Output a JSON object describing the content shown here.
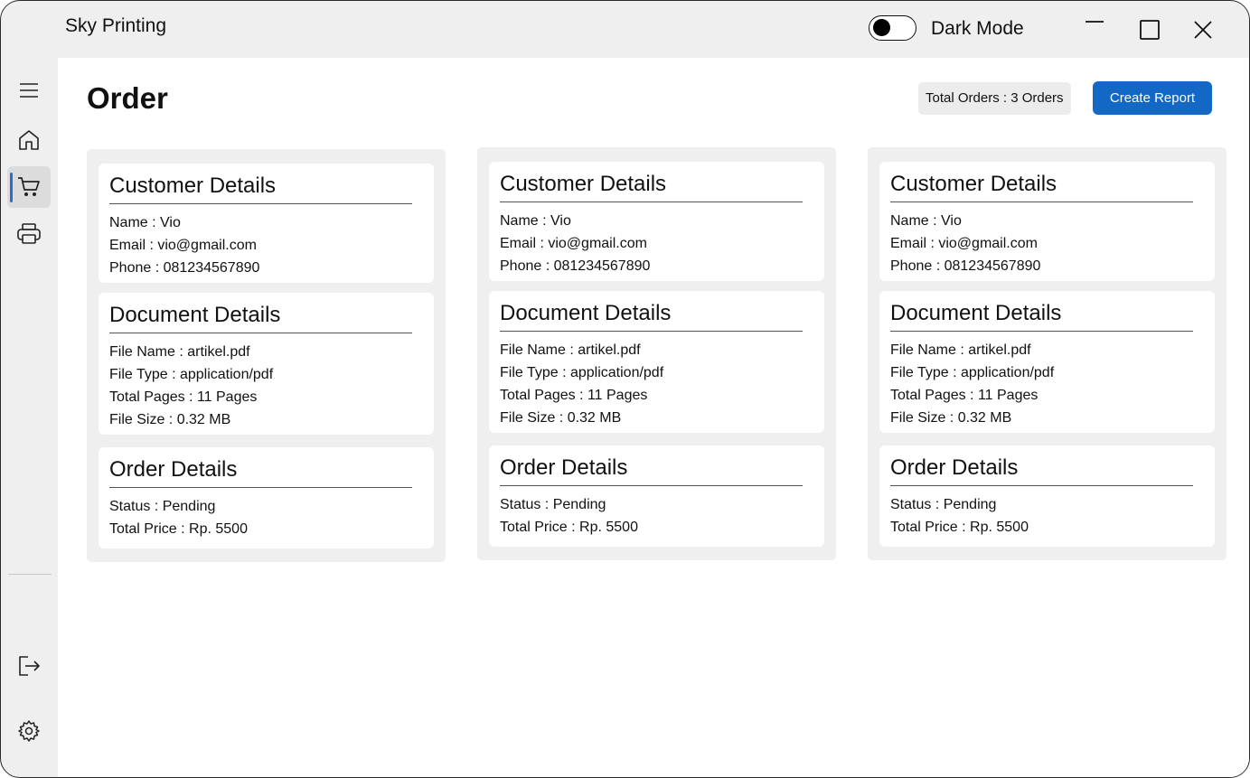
{
  "app": {
    "title": "Sky Printing",
    "dark_mode_label": "Dark Mode",
    "dark_mode_on": false
  },
  "colors": {
    "accent": "#1268c4",
    "panel_background": "#efefef",
    "active_indicator": "#2a6fc9"
  },
  "sidebar": {
    "items": [
      {
        "icon": "menu-icon"
      },
      {
        "icon": "home-icon"
      },
      {
        "icon": "cart-icon",
        "active": true
      },
      {
        "icon": "printer-icon"
      },
      {
        "icon": "logout-icon"
      },
      {
        "icon": "settings-icon"
      }
    ]
  },
  "header": {
    "title": "Order",
    "total_orders": "Total Orders : 3 Orders",
    "create_report_label": "Create Report"
  },
  "orders": [
    {
      "customer": {
        "title": "Customer Details",
        "name": "Name : Vio",
        "email": "Email : vio@gmail.com",
        "phone": "Phone : 081234567890"
      },
      "document": {
        "title": "Document Details",
        "file_name": "File Name : artikel.pdf",
        "file_type": "File Type : application/pdf",
        "total_pages": "Total Pages : 11 Pages",
        "file_size": "File Size : 0.32 MB"
      },
      "order": {
        "title": "Order Details",
        "status": "Status : Pending",
        "total_price": "Total Price : Rp. 5500"
      }
    },
    {
      "customer": {
        "title": "Customer Details",
        "name": "Name : Vio",
        "email": "Email : vio@gmail.com",
        "phone": "Phone : 081234567890"
      },
      "document": {
        "title": "Document Details",
        "file_name": "File Name : artikel.pdf",
        "file_type": "File Type : application/pdf",
        "total_pages": "Total Pages : 11 Pages",
        "file_size": "File Size : 0.32 MB"
      },
      "order": {
        "title": "Order Details",
        "status": "Status : Pending",
        "total_price": "Total Price : Rp. 5500"
      }
    },
    {
      "customer": {
        "title": "Customer Details",
        "name": "Name : Vio",
        "email": "Email : vio@gmail.com",
        "phone": "Phone : 081234567890"
      },
      "document": {
        "title": "Document Details",
        "file_name": "File Name : artikel.pdf",
        "file_type": "File Type : application/pdf",
        "total_pages": "Total Pages : 11 Pages",
        "file_size": "File Size : 0.32 MB"
      },
      "order": {
        "title": "Order Details",
        "status": "Status : Pending",
        "total_price": "Total Price : Rp. 5500"
      }
    }
  ]
}
